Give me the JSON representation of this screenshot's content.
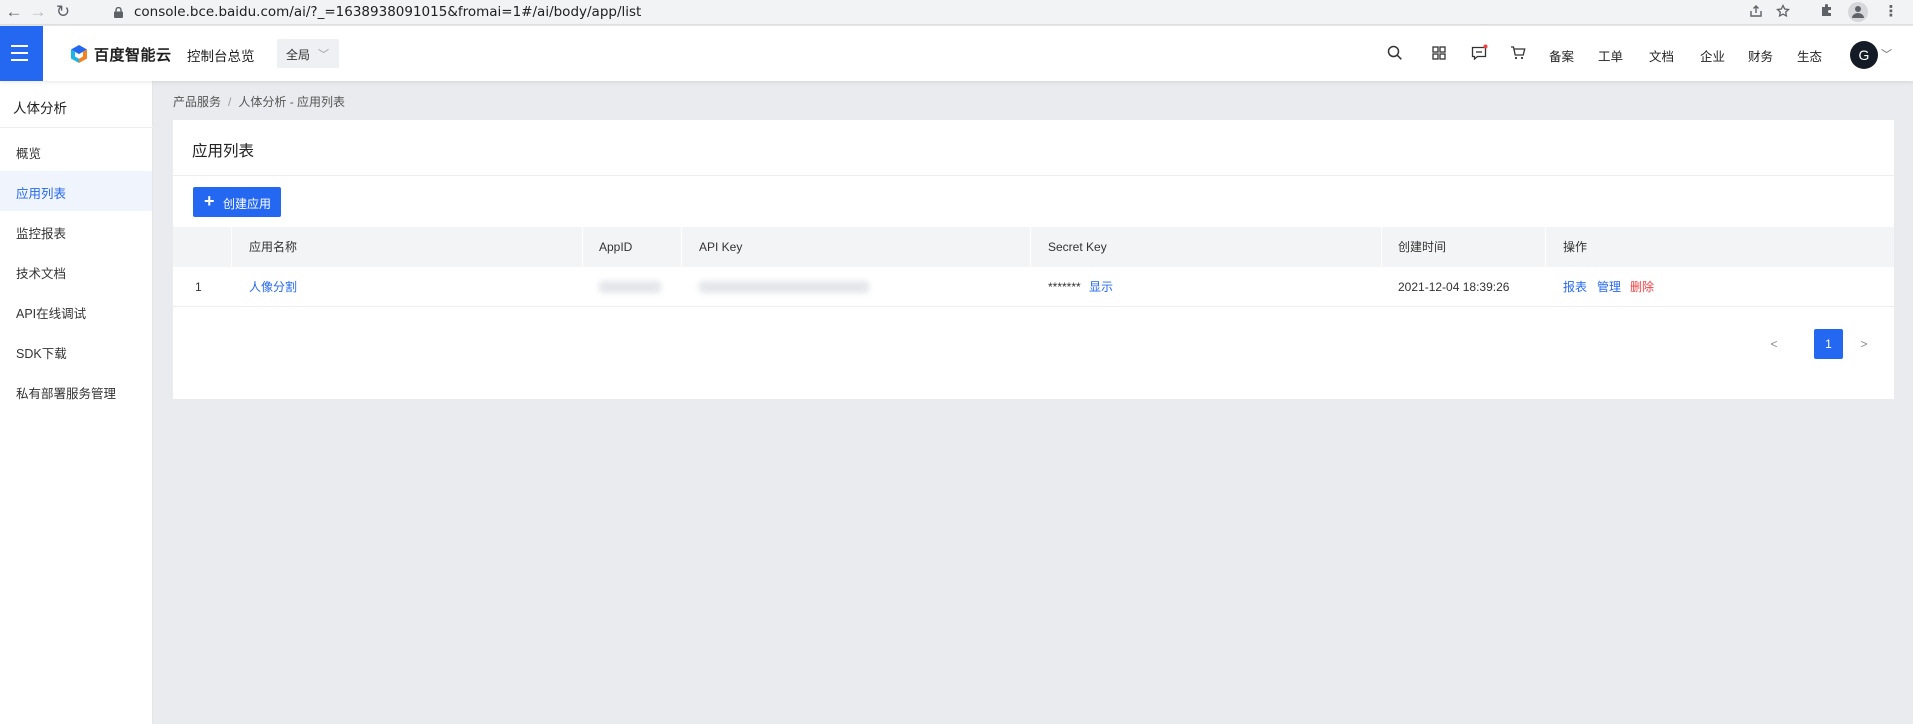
{
  "browser": {
    "url": "console.bce.baidu.com/ai/?_=1638938091015&fromai=1#/ai/body/app/list",
    "back_icon": "←",
    "forward_icon": "→",
    "reload_icon": "↻"
  },
  "topnav": {
    "brand": "百度智能云",
    "console_link": "控制台总览",
    "region": "全局",
    "links": [
      "备案",
      "工单",
      "文档",
      "企业",
      "财务",
      "生态"
    ],
    "avatar_letter": "G",
    "accent": "#2468f2",
    "notification_dot": "#f33e3e"
  },
  "sidebar": {
    "title": "人体分析",
    "items": [
      {
        "label": "概览"
      },
      {
        "label": "应用列表"
      },
      {
        "label": "监控报表"
      },
      {
        "label": "技术文档"
      },
      {
        "label": "API在线调试"
      },
      {
        "label": "SDK下载"
      },
      {
        "label": "私有部署服务管理"
      }
    ],
    "active_index": 1
  },
  "breadcrumb": {
    "root": "产品服务",
    "separator": "/",
    "current": "人体分析 - 应用列表"
  },
  "card": {
    "title": "应用列表",
    "create_button": "创建应用"
  },
  "table": {
    "headers": [
      "应用名称",
      "AppID",
      "API Key",
      "Secret Key",
      "创建时间",
      "操作"
    ],
    "rows": [
      {
        "index": "1",
        "name": "人像分割",
        "secret_mask": "*******",
        "secret_show": "显示",
        "created": "2021-12-04 18:39:26",
        "actions": [
          "报表",
          "管理",
          "删除"
        ]
      }
    ]
  },
  "pagination": {
    "prev": "<",
    "current_page": "1",
    "next": ">"
  }
}
